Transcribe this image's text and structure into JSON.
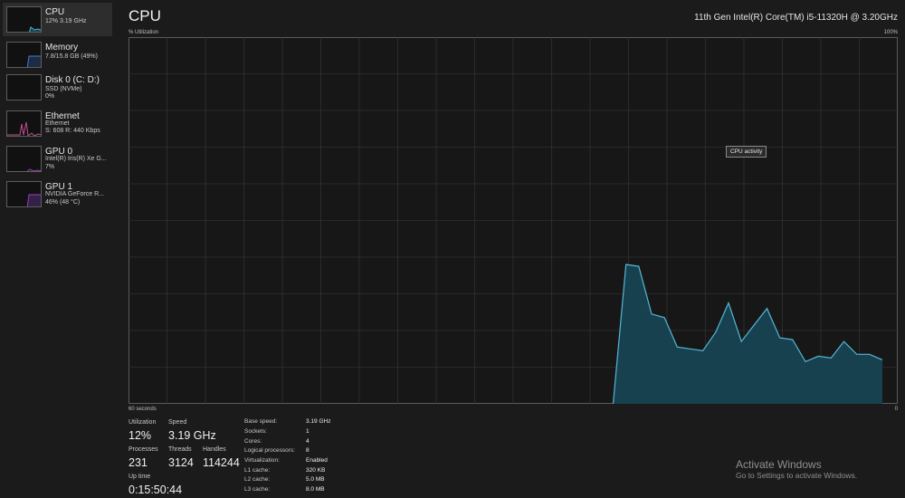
{
  "sidebar": {
    "items": [
      {
        "title": "CPU",
        "sub1": "12% 3.19 GHz",
        "sub2": "",
        "sub3": ""
      },
      {
        "title": "Memory",
        "sub1": "7.8/15.8 GB (49%)",
        "sub2": "",
        "sub3": ""
      },
      {
        "title": "Disk 0 (C: D:)",
        "sub1": "SSD (NVMe)",
        "sub2": "0%",
        "sub3": ""
      },
      {
        "title": "Ethernet",
        "sub1": "Ethernet",
        "sub2": "S: 608 R: 440 Kbps",
        "sub3": ""
      },
      {
        "title": "GPU 0",
        "sub1": "Intel(R) Iris(R) Xe G...",
        "sub2": "7%",
        "sub3": ""
      },
      {
        "title": "GPU 1",
        "sub1": "NVIDIA GeForce R...",
        "sub2": "46% (48 °C)",
        "sub3": ""
      }
    ],
    "colors": {
      "cpu": "#4fb3d9",
      "memory": "#4a78c9",
      "disk": "#6aa84f",
      "ethernet": "#c05090",
      "gpu": "#9b3fb5"
    }
  },
  "header": {
    "title": "CPU",
    "cpu_model": "11th Gen Intel(R) Core(TM) i5-11320H @ 3.20GHz",
    "util_label": "% Utilization",
    "max_label": "100%",
    "time_label": "60 seconds",
    "min_label": "0"
  },
  "graph": {
    "tooltip": "CPU activity",
    "line_color": "#55b6d6",
    "fill_color": "#17414f",
    "grid_color": "#3a3a3a",
    "x_max": 60,
    "y_max": 100,
    "points": [
      [
        37.8,
        0
      ],
      [
        38.8,
        38
      ],
      [
        39.8,
        37.5
      ],
      [
        40.8,
        24.5
      ],
      [
        41.8,
        23.5
      ],
      [
        42.8,
        15.5
      ],
      [
        43.8,
        15.0
      ],
      [
        44.8,
        14.5
      ],
      [
        45.8,
        19.5
      ],
      [
        46.8,
        27.5
      ],
      [
        47.8,
        17.0
      ],
      [
        48.8,
        21.5
      ],
      [
        49.8,
        26.0
      ],
      [
        50.8,
        18.0
      ],
      [
        51.8,
        17.5
      ],
      [
        52.8,
        11.5
      ],
      [
        53.8,
        13.0
      ],
      [
        54.8,
        12.5
      ],
      [
        55.8,
        17.0
      ],
      [
        56.8,
        13.5
      ],
      [
        57.8,
        13.5
      ],
      [
        58.8,
        12.0
      ]
    ]
  },
  "stats": {
    "utilization_label": "Utilization",
    "utilization": "12%",
    "speed_label": "Speed",
    "speed": "3.19 GHz",
    "processes_label": "Processes",
    "processes": "231",
    "threads_label": "Threads",
    "threads": "3124",
    "handles_label": "Handles",
    "handles": "114244",
    "uptime_label": "Up time",
    "uptime": "0:15:50:44"
  },
  "specs": [
    {
      "label": "Base speed:",
      "value": "3.19 GHz"
    },
    {
      "label": "Sockets:",
      "value": "1"
    },
    {
      "label": "Cores:",
      "value": "4"
    },
    {
      "label": "Logical processors:",
      "value": "8"
    },
    {
      "label": "Virtualization:",
      "value": "Enabled"
    },
    {
      "label": "L1 cache:",
      "value": "320 KB"
    },
    {
      "label": "L2 cache:",
      "value": "5.0 MB"
    },
    {
      "label": "L3 cache:",
      "value": "8.0 MB"
    }
  ],
  "watermark": {
    "title": "Activate Windows",
    "subtitle": "Go to Settings to activate Windows."
  }
}
